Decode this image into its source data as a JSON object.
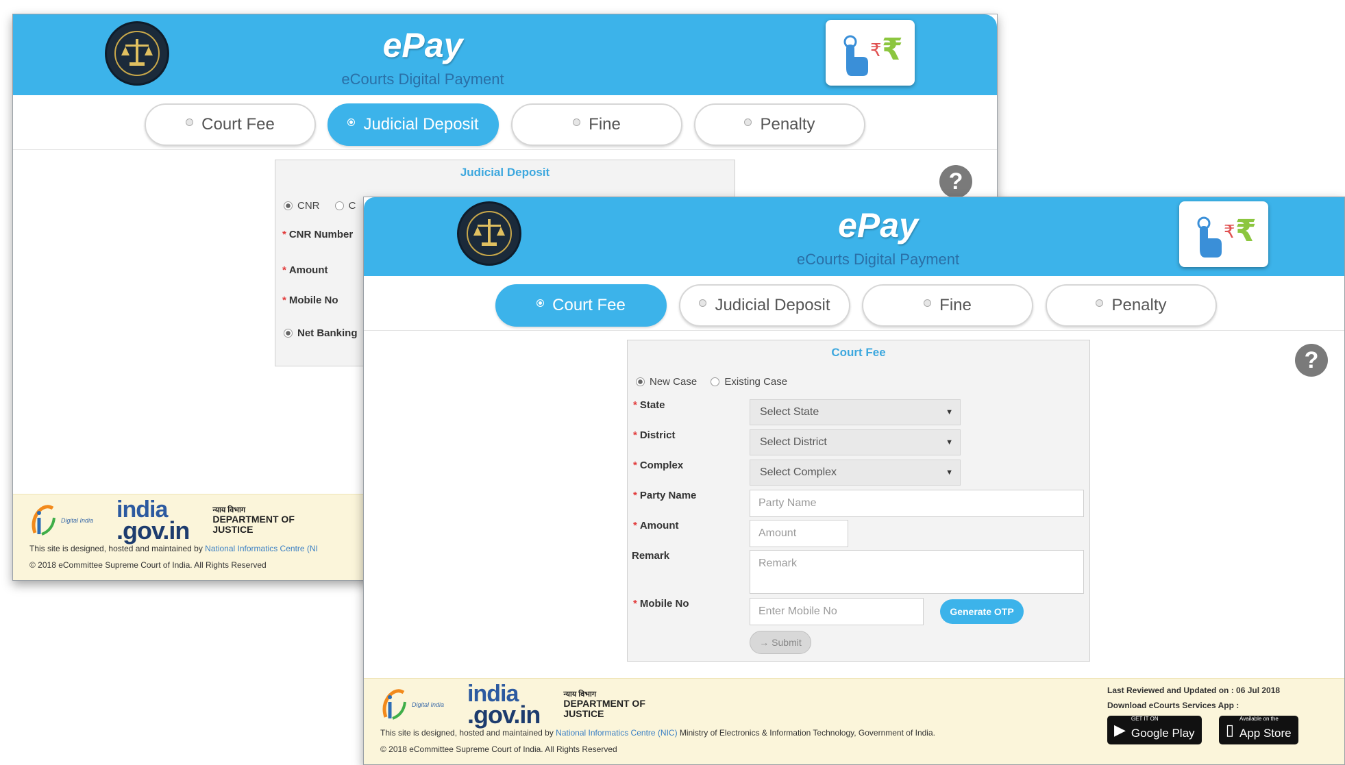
{
  "colors": {
    "brand_blue": "#3cb3ea",
    "title_blue": "#3ca7de",
    "footer_bg": "#fbf5da",
    "help_grey": "#7a7a7a"
  },
  "icons": {
    "emblem": "supreme-court-emblem-icon",
    "epay": "hand-tap-rupee-icon",
    "help": "question-mark-icon",
    "digital_india": "digital-india-logo",
    "google_play": "play-triangle-icon",
    "app_store": "phone-icon"
  },
  "back_window": {
    "app_title": "ePay",
    "app_subtitle": "eCourts Digital Payment",
    "tabs": [
      {
        "label": "Court Fee",
        "active": false
      },
      {
        "label": "Judicial Deposit",
        "active": true
      },
      {
        "label": "Fine",
        "active": false
      },
      {
        "label": "Penalty",
        "active": false
      }
    ],
    "panel_title": "Judicial Deposit",
    "radio_cnr": "CNR",
    "radio_other": "C",
    "fields": {
      "cnr_number": "CNR Number",
      "amount": "Amount",
      "mobile_no": "Mobile No"
    },
    "payment_option": "Net Banking",
    "footer": {
      "digital_india_text": "Digital India",
      "india_gov_1": "india",
      "india_gov_2": ".gov.in",
      "doj_hindi": "न्याय विभाग",
      "doj_line1": "DEPARTMENT OF",
      "doj_line2": "JUSTICE",
      "designed_prefix": "This site is designed, hosted and maintained by",
      "designed_link": "National Informatics Centre (NI",
      "copyright": "© 2018 eCommittee Supreme Court of India. All Rights Reserved"
    }
  },
  "front_window": {
    "app_title": "ePay",
    "app_subtitle": "eCourts Digital Payment",
    "tabs": [
      {
        "label": "Court Fee",
        "active": true
      },
      {
        "label": "Judicial Deposit",
        "active": false
      },
      {
        "label": "Fine",
        "active": false
      },
      {
        "label": "Penalty",
        "active": false
      }
    ],
    "panel_title": "Court Fee",
    "case_type": {
      "new": "New Case",
      "existing": "Existing Case",
      "selected": "New Case"
    },
    "labels": {
      "state": "State",
      "district": "District",
      "complex": "Complex",
      "party_name": "Party Name",
      "amount": "Amount",
      "remark": "Remark",
      "mobile_no": "Mobile No"
    },
    "selects": {
      "state": "Select State",
      "district": "Select District",
      "complex": "Select Complex"
    },
    "placeholders": {
      "party_name": "Party Name",
      "amount": "Amount",
      "remark": "Remark",
      "mobile_no": "Enter Mobile No"
    },
    "generate_otp": "Generate OTP",
    "submit": "→ Submit",
    "footer": {
      "digital_india_text": "Digital India",
      "india_gov_1": "india",
      "india_gov_2": ".gov.in",
      "doj_hindi": "न्याय विभाग",
      "doj_line1": "DEPARTMENT OF",
      "doj_line2": "JUSTICE",
      "designed_prefix": "This site is designed, hosted and maintained by",
      "designed_link": "National Informatics Centre (NIC)",
      "designed_suffix": "Ministry of Electronics & Information Technology, Government of India.",
      "copyright": "© 2018 eCommittee Supreme Court of India. All Rights Reserved",
      "last_reviewed": "Last Reviewed and Updated on : 06 Jul 2018",
      "download_app": "Download eCourts Services App :",
      "google_play_small": "GET IT ON",
      "google_play_big": "Google Play",
      "app_store_small": "Available on the",
      "app_store_big": "App Store"
    }
  }
}
